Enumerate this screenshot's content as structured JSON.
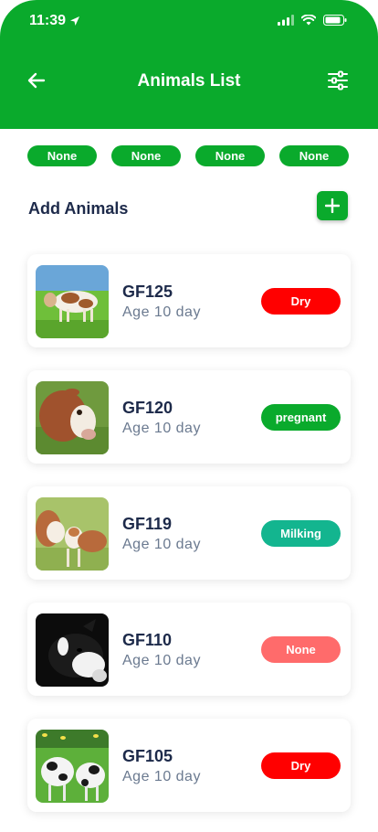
{
  "status_bar": {
    "time": "11:39"
  },
  "header": {
    "title": "Animals List"
  },
  "filters": [
    "None",
    "None",
    "None",
    "None"
  ],
  "add_section": {
    "label": "Add Animals"
  },
  "animals": [
    {
      "id": "GF125",
      "age": "Age 10 day",
      "status": "Dry",
      "status_color": "#ff0000"
    },
    {
      "id": "GF120",
      "age": "Age 10 day",
      "status": "pregnant",
      "status_color": "#0aaa2c"
    },
    {
      "id": "GF119",
      "age": "Age 10 day",
      "status": "Milking",
      "status_color": "#13b58f"
    },
    {
      "id": "GF110",
      "age": "Age 10 day",
      "status": "None",
      "status_color": "#ff6b6b"
    },
    {
      "id": "GF105",
      "age": "Age 10 day",
      "status": "Dry",
      "status_color": "#ff0000"
    }
  ],
  "colors": {
    "primary": "#0aaa2c",
    "text_dark": "#1d2a4a",
    "text_muted": "#6b7a90"
  }
}
